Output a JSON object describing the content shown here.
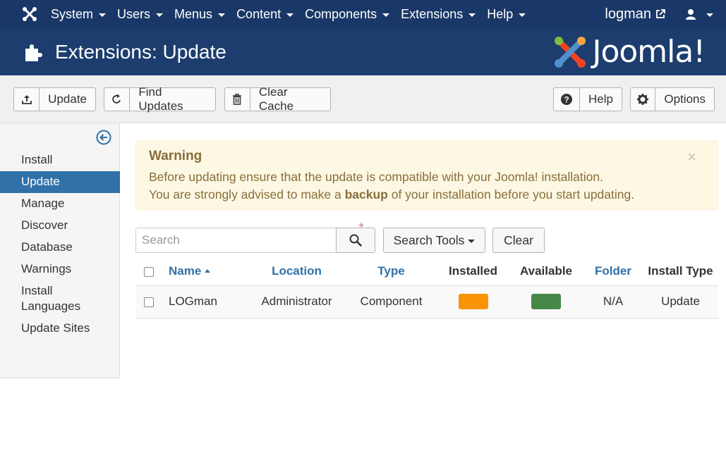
{
  "navbar": {
    "logo_icon": "joomla-logo-icon",
    "menus": [
      {
        "label": "System"
      },
      {
        "label": "Users"
      },
      {
        "label": "Menus"
      },
      {
        "label": "Content"
      },
      {
        "label": "Components"
      },
      {
        "label": "Extensions"
      },
      {
        "label": "Help"
      }
    ],
    "site_link": "logman",
    "user_icon": "user-icon"
  },
  "header": {
    "title": "Extensions: Update",
    "brand": "Joomla!",
    "icon": "puzzle-piece-icon",
    "background": "#1c3d6e"
  },
  "toolbar": {
    "update_label": "Update",
    "find_updates_label": "Find Updates",
    "clear_cache_label": "Clear Cache",
    "help_label": "Help",
    "options_label": "Options"
  },
  "sidebar": {
    "items": [
      {
        "label": "Install"
      },
      {
        "label": "Update"
      },
      {
        "label": "Manage"
      },
      {
        "label": "Discover"
      },
      {
        "label": "Database"
      },
      {
        "label": "Warnings"
      },
      {
        "label": "Install Languages"
      },
      {
        "label": "Update Sites"
      }
    ],
    "active": "Update",
    "accent": "#3071a9"
  },
  "warning": {
    "heading": "Warning",
    "line1": "Before updating ensure that the update is compatible with your Joomla! installation.",
    "line2_pre": "You are strongly advised to make a ",
    "line2_bold": "backup",
    "line2_post": " of your installation before you start updating.",
    "close": "×"
  },
  "filters": {
    "search_placeholder": "Search",
    "search_tools_label": "Search Tools",
    "clear_label": "Clear"
  },
  "table": {
    "headers": {
      "name": "Name",
      "location": "Location",
      "type": "Type",
      "installed": "Installed",
      "available": "Available",
      "folder": "Folder",
      "install_type": "Install Type"
    },
    "rows": [
      {
        "name": "LOGman",
        "location": "Administrator",
        "type": "Component",
        "installed_color": "#f89406",
        "available_color": "#468847",
        "folder": "N/A",
        "install_type": "Update"
      }
    ]
  }
}
